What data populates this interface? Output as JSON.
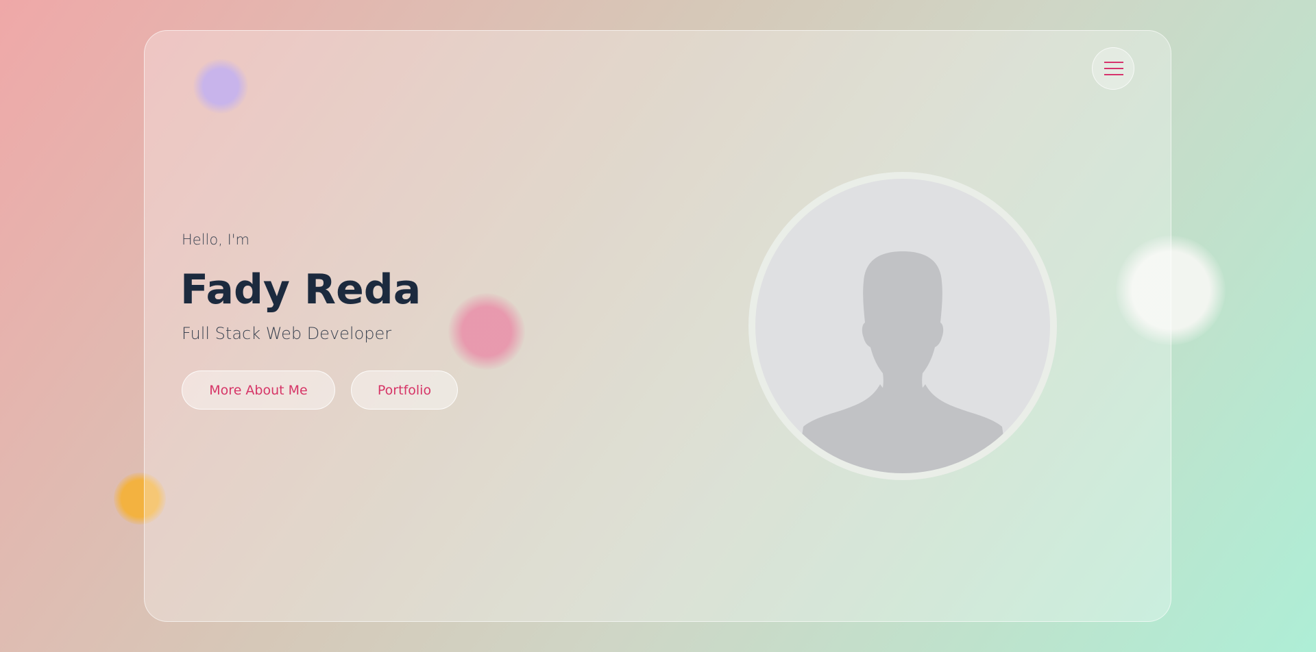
{
  "hero": {
    "greeting": "Hello, I'm",
    "name": "Fady Reda",
    "role": "Full Stack Web Developer"
  },
  "buttons": {
    "about_label": "More About Me",
    "portfolio_label": "Portfolio"
  },
  "header": {
    "menu_icon": "hamburger-menu-icon"
  },
  "avatar": {
    "icon": "user-silhouette-icon"
  },
  "colors": {
    "accent": "#d63466",
    "heading": "#1c2a3e",
    "text": "#3a4250",
    "blob_purple": "#b096e6",
    "blob_pink": "#e896ac",
    "blob_orange": "#f3b240"
  }
}
